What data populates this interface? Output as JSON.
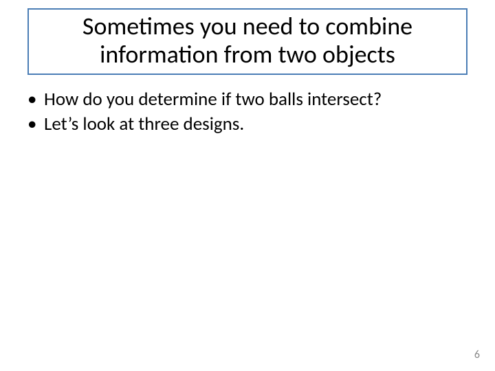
{
  "title": {
    "line1": "Sometimes you need to combine",
    "line2": "information from two objects"
  },
  "bullets": [
    "How do you determine if two balls intersect?",
    "Let’s look at three designs."
  ],
  "bullet_glyph": "•",
  "page_number": "6"
}
